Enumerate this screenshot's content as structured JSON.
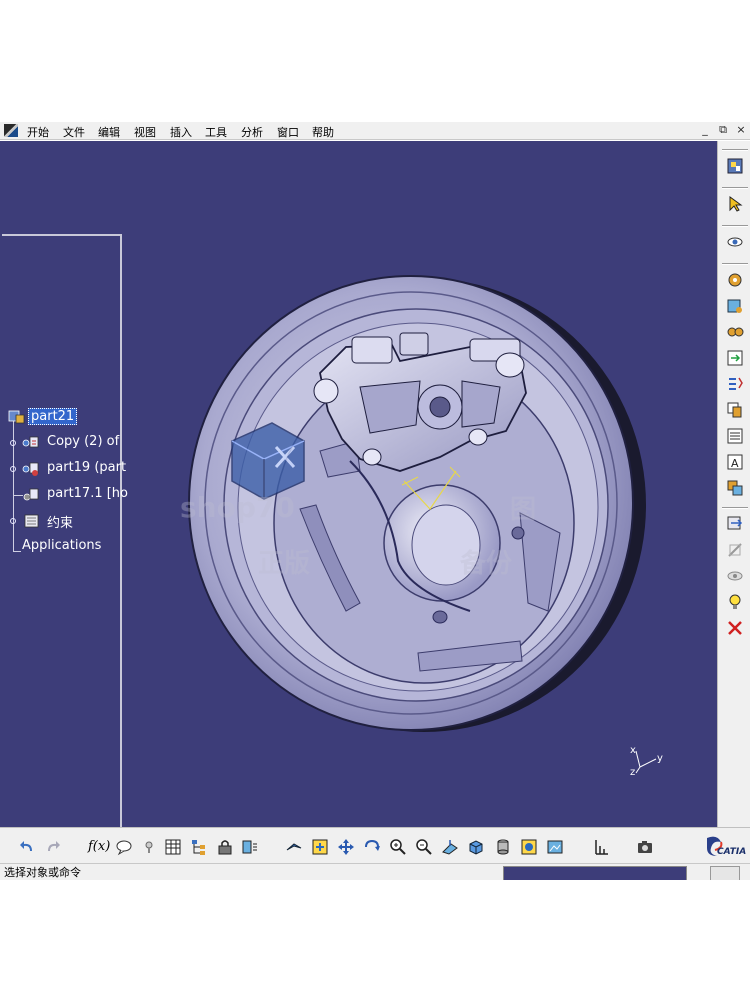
{
  "menu": {
    "items": [
      "开始",
      "文件",
      "编辑",
      "视图",
      "插入",
      "工具",
      "分析",
      "窗口",
      "帮助"
    ],
    "window_controls": [
      "_",
      "⧉",
      "×"
    ]
  },
  "tree": {
    "root_label": "part21",
    "nodes": [
      {
        "label": "Copy (2) of"
      },
      {
        "label": "part19 (part"
      },
      {
        "label": "part17.1 [ho"
      },
      {
        "label": "约束"
      },
      {
        "label": "Applications"
      }
    ]
  },
  "viewport": {
    "background": "#3d3d79",
    "axis_labels": {
      "x": "x",
      "y": "y",
      "z": "z"
    },
    "watermark_lines": [
      "shop70",
      "图",
      "正版",
      "备份"
    ]
  },
  "toolbars": {
    "right_icons": [
      "catalog-icon",
      "select-arrow-icon",
      "eye-snap-icon",
      "gear-assembly-icon",
      "existing-component-icon",
      "replace-component-icon",
      "graph-tree-icon",
      "reorder-icon",
      "numbering-icon",
      "bill-of-material-icon",
      "publication-icon",
      "multi-instantiation-icon",
      "fast-multi-instantiation-icon",
      "hide-show-icon",
      "light-bulb-icon",
      "delete-icon"
    ],
    "bottom_icons": [
      "undo-icon",
      "redo-icon",
      "formula-icon",
      "comment-icon",
      "hint-icon",
      "table-icon",
      "tree-icon",
      "lock-icon",
      "sketch-icon",
      "fly-icon",
      "fit-all-icon",
      "pan-icon",
      "rotate-icon",
      "zoom-in-icon",
      "zoom-out-icon",
      "normal-view-icon",
      "iso-view-icon",
      "shading-icon",
      "cylinder-icon",
      "render-icon",
      "measure-icon",
      "camera-icon"
    ],
    "fx_label": "f(x)"
  },
  "brand": {
    "name": "CATIA"
  },
  "status": {
    "text": "选择对象或命令"
  }
}
